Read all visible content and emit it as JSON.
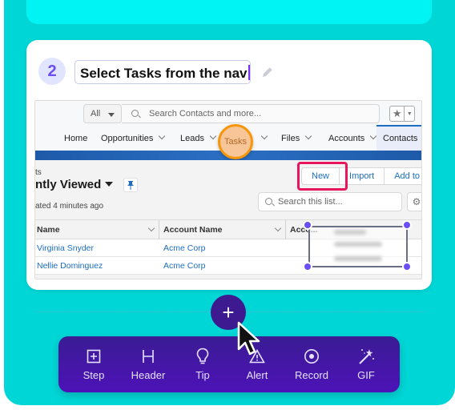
{
  "step": {
    "number": "2",
    "title": "Select Tasks from the nav"
  },
  "salesforce": {
    "search_scope": "All",
    "search_placeholder": "Search Contacts and more...",
    "nav": {
      "items": [
        "Home",
        "Opportunities",
        "Leads",
        "Tasks",
        "Files",
        "Accounts",
        "Contacts"
      ],
      "highlighted": "Tasks",
      "active": "Contacts"
    },
    "list_view": {
      "object_label": "ts",
      "title": "ntly Viewed",
      "updated": "ated 4 minutes ago",
      "buttons": [
        "New",
        "Import",
        "Add to"
      ],
      "highlighted_button": "New",
      "search_placeholder": "Search this list..."
    },
    "table": {
      "columns": [
        "Name",
        "Account Name",
        "Acco..."
      ],
      "rows": [
        {
          "name": "Virginia Snyder",
          "account": "Acme Corp"
        },
        {
          "name": "Nellie Dominguez",
          "account": "Acme Corp"
        }
      ]
    }
  },
  "colors": {
    "background": "#00d6d6",
    "accent": "#6b4ff5",
    "toolbar": "#3a1c93",
    "highlight_orange": "#f5960a",
    "highlight_pink": "#e8175d"
  },
  "toolbar": {
    "add_button": "+",
    "items": [
      {
        "icon": "step-icon",
        "label": "Step"
      },
      {
        "icon": "header-icon",
        "label": "Header"
      },
      {
        "icon": "lightbulb-icon",
        "label": "Tip"
      },
      {
        "icon": "alert-icon",
        "label": "Alert"
      },
      {
        "icon": "record-icon",
        "label": "Record"
      },
      {
        "icon": "magic-wand-icon",
        "label": "GIF"
      }
    ]
  }
}
